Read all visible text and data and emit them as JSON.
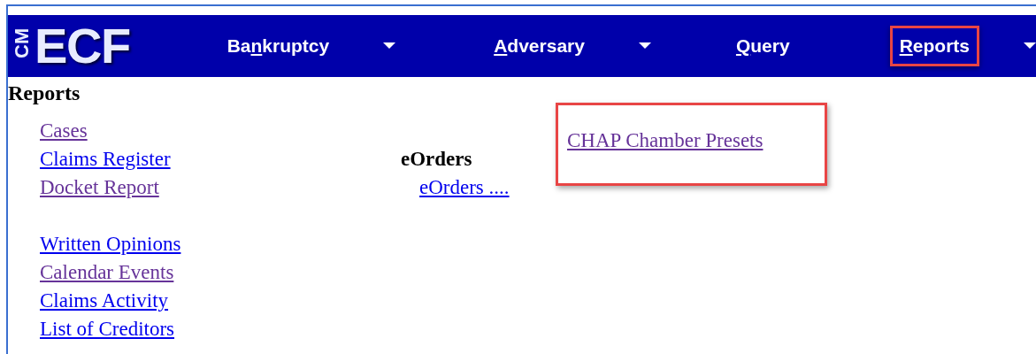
{
  "logo": {
    "side_text": "CM",
    "main_text": "ECF"
  },
  "nav": [
    {
      "label_before": "Ba",
      "access_key": "n",
      "label_after": "kruptcy",
      "dropdown": true,
      "highlighted": false
    },
    {
      "access_key": "A",
      "label_after": "dversary",
      "dropdown": true,
      "highlighted": false
    },
    {
      "access_key": "Q",
      "label_after": "uery",
      "dropdown": false,
      "highlighted": false
    },
    {
      "access_key": "R",
      "label_after": "eports",
      "dropdown": true,
      "highlighted": true
    }
  ],
  "page_title": "Reports",
  "left_link_groups": [
    [
      {
        "label": "Cases",
        "visited": true
      },
      {
        "label": "Claims Register",
        "visited": false
      },
      {
        "label": "Docket Report",
        "visited": true
      }
    ],
    [
      {
        "label": "Written Opinions",
        "visited": false
      },
      {
        "label": "Calendar Events",
        "visited": true
      },
      {
        "label": "Claims Activity",
        "visited": false
      },
      {
        "label": "List of Creditors",
        "visited": false
      }
    ]
  ],
  "eorders": {
    "heading": "eOrders",
    "links": [
      {
        "label": "eOrders ....",
        "visited": false
      }
    ]
  },
  "right_links": [
    {
      "label": "CHAP Chamber Presets",
      "visited": true,
      "highlighted": true
    }
  ]
}
